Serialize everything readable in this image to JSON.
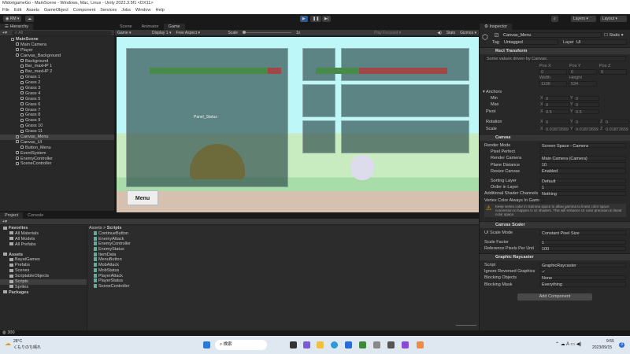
{
  "window": {
    "title": "MidorigameGo - MainScene - Windows, Mac, Linux - Unity 2022.3.5f1 <DX11>"
  },
  "menu": [
    "File",
    "Edit",
    "Assets",
    "GameObject",
    "Component",
    "Services",
    "Jobs",
    "Window",
    "Help"
  ],
  "toolbar": {
    "account": "RM",
    "layers": "Layers",
    "layout": "Layout"
  },
  "hierarchy": {
    "tab": "Hierarchy",
    "search_placeholder": "All",
    "items": [
      {
        "label": "MainScene",
        "depth": 0,
        "bold": true
      },
      {
        "label": "Main Camera",
        "depth": 1
      },
      {
        "label": "Player",
        "depth": 1
      },
      {
        "label": "Canvas_Background",
        "depth": 1
      },
      {
        "label": "Background",
        "depth": 2
      },
      {
        "label": "Bar_maxHP 1",
        "depth": 2
      },
      {
        "label": "Bar_maxHP 2",
        "depth": 2
      },
      {
        "label": "Grass 1",
        "depth": 2
      },
      {
        "label": "Grass 2",
        "depth": 2
      },
      {
        "label": "Grass 3",
        "depth": 2
      },
      {
        "label": "Grass 4",
        "depth": 2
      },
      {
        "label": "Grass 5",
        "depth": 2
      },
      {
        "label": "Grass 6",
        "depth": 2
      },
      {
        "label": "Grass 7",
        "depth": 2
      },
      {
        "label": "Grass 8",
        "depth": 2
      },
      {
        "label": "Grass 9",
        "depth": 2
      },
      {
        "label": "Grass 10",
        "depth": 2
      },
      {
        "label": "Grass 11",
        "depth": 2
      },
      {
        "label": "Canvas_Menu",
        "depth": 1,
        "selected": true
      },
      {
        "label": "Canvas_UI",
        "depth": 1
      },
      {
        "label": "Button_Menu",
        "depth": 2
      },
      {
        "label": "EventSystem",
        "depth": 1
      },
      {
        "label": "EnemyController",
        "depth": 1
      },
      {
        "label": "SceneController",
        "depth": 1
      }
    ]
  },
  "center": {
    "tabs": [
      "Scene",
      "Animator",
      "Game"
    ],
    "game_toolbar": {
      "mode": "Game",
      "display": "Display 1",
      "aspect": "Free Aspect",
      "scale_label": "Scale",
      "scale_value": "1x",
      "play_mode": "Play Focused",
      "stats": "Stats",
      "gizmos": "Gizmos"
    },
    "game": {
      "panel_label": "Panel_Status",
      "menu_button": "Menu",
      "player_hp_fraction": 0.9,
      "enemy_hp_fraction": 0.33
    }
  },
  "inspector": {
    "tab": "Inspector",
    "object_name": "Canvas_Menu",
    "static_label": "Static",
    "tag_label": "Tag",
    "tag": "Untagged",
    "layer_label": "Layer",
    "layer": "UI",
    "rect_transform": {
      "title": "Rect Transform",
      "note": "Some values driven by Canvas.",
      "pos_x_label": "Pos X",
      "pos_y_label": "Pos Y",
      "pos_z_label": "Pos Z",
      "pos_x": "0",
      "pos_y": "0",
      "pos_z": "0",
      "width_label": "Width",
      "height_label": "Height",
      "width": "1106",
      "height": "534",
      "anchors": "Anchors",
      "min": "Min",
      "max": "Max",
      "pivot": "Pivot",
      "rotation": "Rotation",
      "scale": "Scale",
      "min_x": "0",
      "min_y": "0",
      "max_x": "0",
      "max_y": "0",
      "pivot_x": "0.5",
      "pivot_y": "0.5",
      "rot_x": "0",
      "rot_y": "0",
      "rot_z": "0",
      "scale_x": "0.01872659",
      "scale_y": "0.01872659",
      "scale_z": "0.01872659"
    },
    "canvas": {
      "title": "Canvas",
      "rows": [
        [
          "Render Mode",
          "Screen Space - Camera"
        ],
        [
          "Pixel Perfect",
          ""
        ],
        [
          "Render Camera",
          "Main Camera (Camera)"
        ],
        [
          "Plane Distance",
          "10"
        ],
        [
          "Resize Canvas",
          "Enabled"
        ],
        [
          "Sorting Layer",
          "Default"
        ],
        [
          "Order in Layer",
          "1"
        ],
        [
          "Additional Shader Channels",
          "Nothing"
        ],
        [
          "Vertex Color Always In Gamm",
          ""
        ]
      ],
      "warning": "Keep vertex color in Gamma space to allow gamma to linear color space conversion to happen in UI shaders. This will enhance UI color precision in linear color space."
    },
    "canvas_scaler": {
      "title": "Canvas Scaler",
      "rows": [
        [
          "UI Scale Mode",
          "Constant Pixel Size"
        ],
        [
          "Scale Factor",
          "1"
        ],
        [
          "Reference Pixels Per Unit",
          "100"
        ]
      ]
    },
    "graphic_raycaster": {
      "title": "Graphic Raycaster",
      "rows": [
        [
          "Script",
          "GraphicRaycaster"
        ],
        [
          "Ignore Reversed Graphics",
          "✓"
        ],
        [
          "Blocking Objects",
          "None"
        ],
        [
          "Blocking Mask",
          "Everything"
        ]
      ]
    },
    "add_component": "Add Component"
  },
  "project": {
    "tabs": [
      "Project",
      "Console"
    ],
    "tree": [
      {
        "label": "Favorites",
        "depth": 0,
        "bold": true
      },
      {
        "label": "All Materials",
        "depth": 1
      },
      {
        "label": "All Models",
        "depth": 1
      },
      {
        "label": "All Prefabs",
        "depth": 1
      },
      {
        "label": "Assets",
        "depth": 0,
        "bold": true
      },
      {
        "label": "BayatGames",
        "depth": 1
      },
      {
        "label": "Prefabs",
        "depth": 1
      },
      {
        "label": "Scenes",
        "depth": 1
      },
      {
        "label": "ScriptableObjects",
        "depth": 1
      },
      {
        "label": "Scripts",
        "depth": 1,
        "selected": true
      },
      {
        "label": "Sprites",
        "depth": 1
      },
      {
        "label": "Packages",
        "depth": 0,
        "bold": true
      }
    ],
    "breadcrumb": [
      "Assets",
      "Scripts"
    ],
    "files": [
      "ContinueButton",
      "EnemyAttack",
      "EnemyController",
      "EnemyStatus",
      "ItemData",
      "MenuButton",
      "MobAttack",
      "MobStatus",
      "PlayerAttack",
      "PlayerStatus",
      "SceneController"
    ]
  },
  "status": {
    "count": "300"
  },
  "taskbar": {
    "temp": "28°C",
    "weather": "くもりのち晴れ",
    "search": "検索",
    "time": "9:55",
    "date": "2023/09/15",
    "notif": "3"
  }
}
